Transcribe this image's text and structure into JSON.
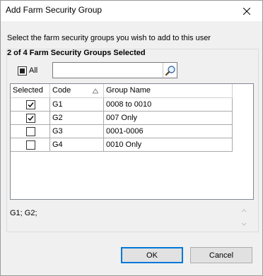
{
  "dialog": {
    "title": "Add Farm Security Group"
  },
  "instruction": "Select the farm security groups you wish to add to this user",
  "group_header": "2 of 4 Farm Security Groups Selected",
  "filter": {
    "all_label": "All",
    "all_state": "indeterminate",
    "search_value": ""
  },
  "grid": {
    "columns": [
      "Selected",
      "Code",
      "Group Name"
    ],
    "sort_column": "Code",
    "sort_direction": "ascending",
    "rows": [
      {
        "selected": true,
        "code": "G1",
        "name": "0008 to 0010"
      },
      {
        "selected": true,
        "code": "G2",
        "name": "007 Only"
      },
      {
        "selected": false,
        "code": "G3",
        "name": "0001-0006"
      },
      {
        "selected": false,
        "code": "G4",
        "name": "0010 Only"
      }
    ]
  },
  "selected_summary": "G1; G2;",
  "buttons": {
    "ok": "OK",
    "cancel": "Cancel"
  },
  "colors": {
    "default_button_border": "#0078d7",
    "titlebar": "#ffffff",
    "window_bg": "#f0f0f0"
  }
}
